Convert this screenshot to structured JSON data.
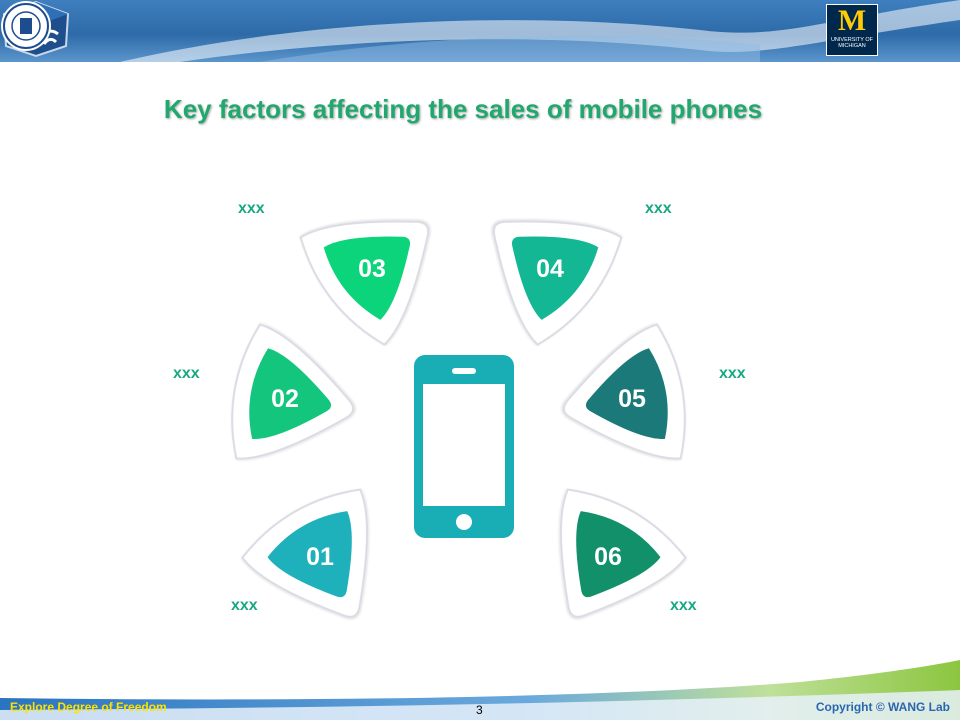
{
  "slide": {
    "title": "Key factors affecting the sales of mobile phones",
    "page_number": "3"
  },
  "header": {
    "left_logo": "lab-cube-logo",
    "um_logo": {
      "letter": "M",
      "line1": "UNIVERSITY OF",
      "line2": "MICHIGAN"
    },
    "right_logo": "sjtu-seal-logo"
  },
  "factors": [
    {
      "number": "01",
      "label": "xxx",
      "color": "#1fb1bb"
    },
    {
      "number": "02",
      "label": "xxx",
      "color": "#14c57d"
    },
    {
      "number": "03",
      "label": "xxx",
      "color": "#0cd47a"
    },
    {
      "number": "04",
      "label": "xxx",
      "color": "#13b794"
    },
    {
      "number": "05",
      "label": "xxx",
      "color": "#1b7a79"
    },
    {
      "number": "06",
      "label": "xxx",
      "color": "#11906a"
    }
  ],
  "center_icon": "smartphone-icon",
  "footer": {
    "left": "Explore Degree of Freedom",
    "right": "Copyright © WANG Lab"
  }
}
